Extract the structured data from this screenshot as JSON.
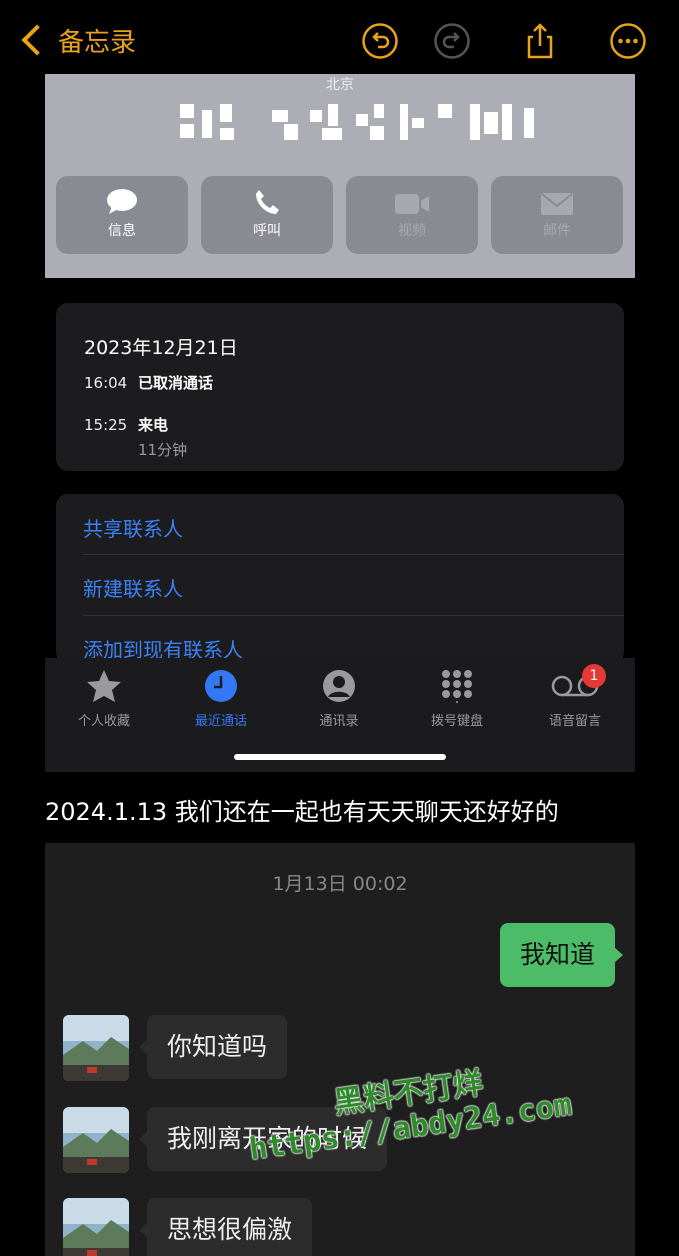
{
  "notes_header": {
    "back_label": "备忘录",
    "icons": [
      "undo-icon",
      "redo-icon",
      "share-icon",
      "more-icon"
    ],
    "accent_color": "#e8a317"
  },
  "contact_screen": {
    "location": "北京",
    "phone_number_obscured": true,
    "buttons": [
      {
        "label": "信息",
        "icon": "message-icon",
        "enabled": true
      },
      {
        "label": "呼叫",
        "icon": "phone-icon",
        "enabled": true
      },
      {
        "label": "视频",
        "icon": "video-icon",
        "enabled": false
      },
      {
        "label": "邮件",
        "icon": "mail-icon",
        "enabled": false
      }
    ],
    "call_history": {
      "date": "2023年12月21日",
      "entries": [
        {
          "time": "16:04",
          "status": "已取消通话"
        },
        {
          "time": "15:25",
          "status": "来电",
          "duration": "11分钟"
        }
      ]
    },
    "actions": [
      "共享联系人",
      "新建联系人",
      "添加到现有联系人"
    ],
    "tabbar": [
      {
        "label": "个人收藏",
        "icon": "star-icon",
        "active": false
      },
      {
        "label": "最近通话",
        "icon": "clock-icon",
        "active": true
      },
      {
        "label": "通讯录",
        "icon": "contact-icon",
        "active": false
      },
      {
        "label": "拨号键盘",
        "icon": "keypad-icon",
        "active": false
      },
      {
        "label": "语音留言",
        "icon": "voicemail-icon",
        "active": false,
        "badge": "1"
      }
    ]
  },
  "caption": "2024.1.13 我们还在一起也有天天聊天还好好的",
  "chat": {
    "timestamp": "1月13日 00:02",
    "messages": [
      {
        "from": "me",
        "text": "我知道"
      },
      {
        "from": "other",
        "text": "你知道吗"
      },
      {
        "from": "other",
        "text": "我刚离开家的时候"
      },
      {
        "from": "other",
        "text": "思想很偏激"
      }
    ]
  },
  "watermark": {
    "line1": "黑料不打烊",
    "line2": "https://abdy24.com"
  }
}
